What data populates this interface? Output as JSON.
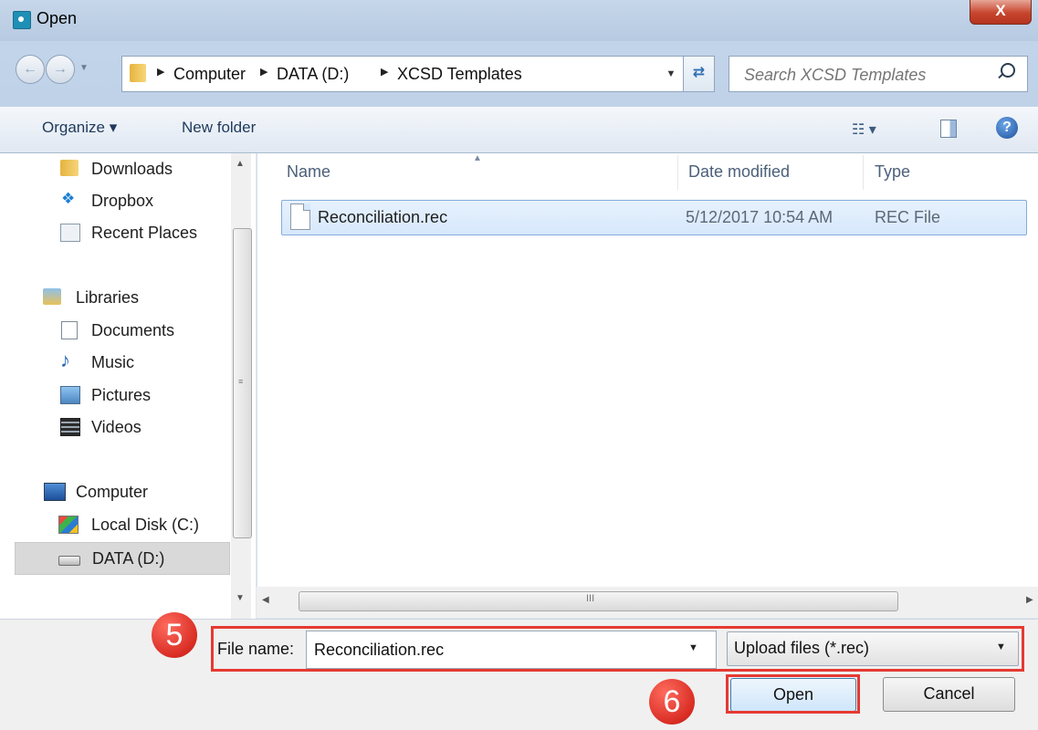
{
  "window": {
    "title": "Open",
    "close_label": "X"
  },
  "address_bar": {
    "crumbs": [
      "Computer",
      "DATA (D:)",
      "XCSD Templates"
    ],
    "search_placeholder": "Search XCSD Templates"
  },
  "toolbar": {
    "organize_label": "Organize ▾",
    "new_folder_label": "New folder",
    "views_label": "☷ ▾",
    "help_label": "?"
  },
  "sidebar": {
    "items": [
      {
        "label": "Downloads",
        "icon": "downloads-folder-icon"
      },
      {
        "label": "Dropbox",
        "icon": "dropbox-icon"
      },
      {
        "label": "Recent Places",
        "icon": "recent-places-icon"
      },
      {
        "label": "Libraries",
        "icon": "libraries-icon"
      },
      {
        "label": "Documents",
        "icon": "documents-icon"
      },
      {
        "label": "Music",
        "icon": "music-icon"
      },
      {
        "label": "Pictures",
        "icon": "pictures-icon"
      },
      {
        "label": "Videos",
        "icon": "videos-icon"
      },
      {
        "label": "Computer",
        "icon": "computer-icon"
      },
      {
        "label": "Local Disk (C:)",
        "icon": "local-disk-icon"
      },
      {
        "label": "DATA (D:)",
        "icon": "drive-icon"
      }
    ]
  },
  "file_list": {
    "columns": [
      "Name",
      "Date modified",
      "Type"
    ],
    "rows": [
      {
        "name": "Reconciliation.rec",
        "date": "5/12/2017 10:54 AM",
        "type": "REC File"
      }
    ],
    "hscroll_grip": "III",
    "vscroll_grip": "≡"
  },
  "bottom": {
    "file_name_label": "File name:",
    "file_name_value": "Reconciliation.rec",
    "filter_value": "Upload files (*.rec)",
    "open_label": "Open",
    "cancel_label": "Cancel"
  },
  "annotations": {
    "step5": "5",
    "step6": "6",
    "accent_color": "#e53a32"
  }
}
